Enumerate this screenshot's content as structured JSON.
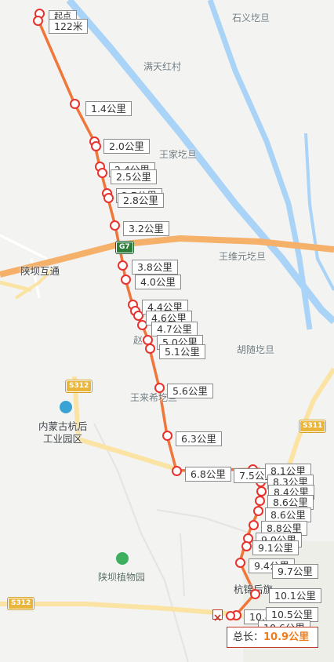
{
  "map": {
    "places": [
      {
        "id": "shiyi",
        "text": "石义圪旦"
      },
      {
        "id": "mantian",
        "text": "满天红村"
      },
      {
        "id": "wangjia",
        "text": "王家圪旦"
      },
      {
        "id": "shanba_hutong",
        "text": "陕坝互通"
      },
      {
        "id": "wangweiyuan",
        "text": "王维元圪旦"
      },
      {
        "id": "zhao",
        "text": "赵"
      },
      {
        "id": "husui",
        "text": "胡随圪旦"
      },
      {
        "id": "wanglaixi",
        "text": "王来希圪旦"
      },
      {
        "id": "neimeng_1",
        "text": "内蒙古杭后"
      },
      {
        "id": "neimeng_2",
        "text": "工业园区"
      },
      {
        "id": "botanical",
        "text": "陕坝植物园"
      },
      {
        "id": "hangjin",
        "text": "杭锦后旗"
      }
    ],
    "road_shields": [
      {
        "id": "g7",
        "text": "G7"
      },
      {
        "id": "s312_a",
        "text": "S312"
      },
      {
        "id": "s312_b",
        "text": "S312"
      },
      {
        "id": "s311",
        "text": "S311"
      }
    ]
  },
  "route": {
    "start_label": "起点",
    "first_label": "122米",
    "distance_labels": [
      "1.4公里",
      "2.0公里",
      "2.4公里",
      "2.5公里",
      "2.7公里",
      "2.8公里",
      "3.2公里",
      "3.8公里",
      "4.0公里",
      "4.4公里",
      "4.6公里",
      "4.7公里",
      "5.0公里",
      "5.1公里",
      "5.6公里",
      "6.3公里",
      "6.8公里",
      "7.5公里",
      "8.1公里",
      "8.3公里",
      "8.4公里",
      "8.6公里",
      "8.6公里",
      "8.8公里",
      "9.0公里",
      "9.1公里",
      "9.4公里",
      "9.7公里",
      "10.1公里",
      "10.4公里",
      "10.5公里",
      "10.6公里"
    ],
    "total_label": "总长：",
    "total_value": "10.9公里"
  },
  "colors": {
    "route_line": "#f0763a",
    "point_ring": "#e8322d",
    "river": "#a9d3f7",
    "highway": "#f5b06a",
    "provincial_road": "#fbe3a3"
  }
}
